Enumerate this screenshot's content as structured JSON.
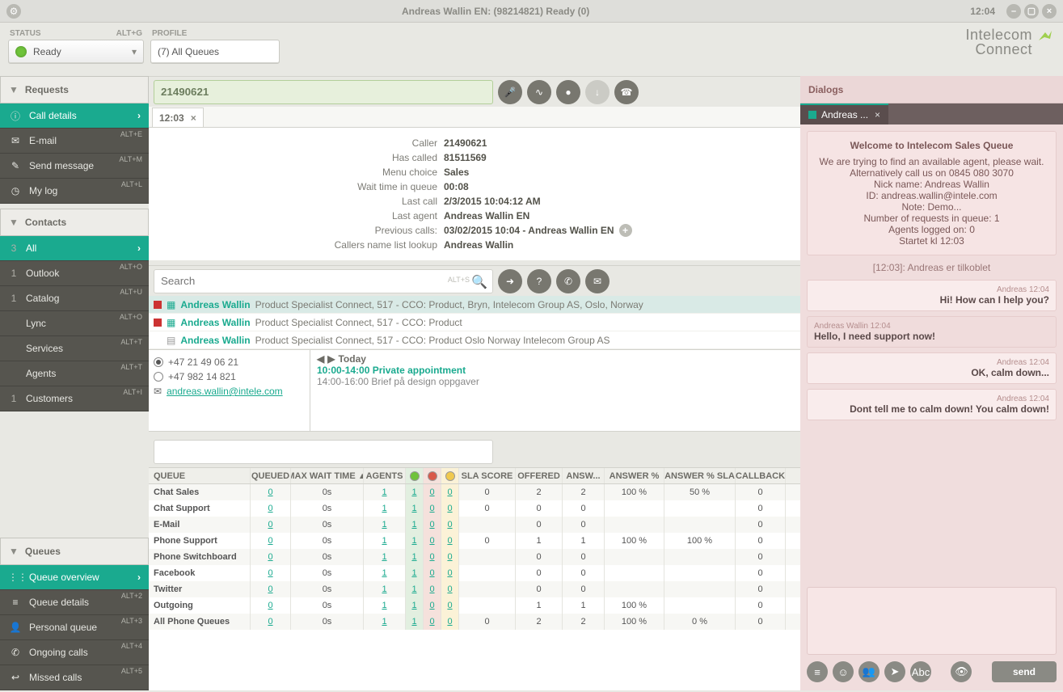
{
  "titlebar": {
    "title": "Andreas Wallin EN: (98214821) Ready  (0)",
    "clock": "12:04"
  },
  "status": {
    "label": "STATUS",
    "shortcut": "ALT+G",
    "value": "Ready"
  },
  "profile": {
    "label": "PROFILE",
    "value": "(7) All Queues"
  },
  "brand": {
    "line1": "Intelecom",
    "line2": "Connect"
  },
  "requests": {
    "hdr": "Requests",
    "items": [
      {
        "icon": "ⓘ",
        "label": "Call details",
        "active": true
      },
      {
        "icon": "✉",
        "label": "E-mail",
        "sc": "ALT+E"
      },
      {
        "icon": "✎",
        "label": "Send message",
        "sc": "ALT+M"
      },
      {
        "icon": "◷",
        "label": "My log",
        "sc": "ALT+L"
      }
    ]
  },
  "callbar": {
    "number": "21490621"
  },
  "tab": {
    "time": "12:03"
  },
  "calldetails": [
    {
      "k": "Caller",
      "v": "21490621"
    },
    {
      "k": "Has called",
      "v": "81511569"
    },
    {
      "k": "Menu choice",
      "v": "Sales"
    },
    {
      "k": "Wait time in queue",
      "v": "00:08"
    },
    {
      "k": "Last call",
      "v": "2/3/2015 10:04:12 AM"
    },
    {
      "k": "Last agent",
      "v": "Andreas Wallin EN"
    },
    {
      "k": "Previous calls:",
      "v": "03/02/2015 10:04 - Andreas Wallin EN",
      "plus": true
    },
    {
      "k": "Callers name list lookup",
      "v": "Andreas Wallin"
    }
  ],
  "contacts": {
    "hdr": "Contacts",
    "searchPlaceholder": "Search",
    "searchShortcut": "ALT+S",
    "items": [
      {
        "cnt": "3",
        "label": "All",
        "active": true
      },
      {
        "cnt": "1",
        "label": "Outlook",
        "sc": "ALT+O"
      },
      {
        "cnt": "1",
        "label": "Catalog",
        "sc": "ALT+U"
      },
      {
        "cnt": "",
        "label": "Lync",
        "sc": "ALT+O"
      },
      {
        "cnt": "",
        "label": "Services",
        "sc": "ALT+T"
      },
      {
        "cnt": "",
        "label": "Agents",
        "sc": "ALT+T"
      },
      {
        "cnt": "1",
        "label": "Customers",
        "sc": "ALT+I"
      }
    ],
    "results": [
      {
        "status": true,
        "name": "Andreas Wallin",
        "rest": "Product Specialist Connect,  517 - CCO: Product,  Bryn,  Intelecom Group AS,  Oslo,  Norway",
        "sel": true
      },
      {
        "status": true,
        "name": "Andreas Wallin",
        "rest": "Product Specialist Connect,  517 - CCO: Product"
      },
      {
        "status": false,
        "name": "Andreas Wallin",
        "rest": "Product Specialist Connect,  517 - CCO: Product Oslo Norway Intelecom Group AS"
      }
    ],
    "detail": {
      "phones": [
        {
          "num": "+47 21 49 06 21",
          "sel": true
        },
        {
          "num": "+47 982 14 821",
          "sel": false
        }
      ],
      "email": "andreas.wallin@intele.com",
      "today": "Today",
      "events": [
        {
          "time": "10:00-14:00",
          "title": "Private appointment",
          "hl": true
        },
        {
          "time": "14:00-16:00",
          "title": "Brief på design oppgaver"
        }
      ]
    }
  },
  "queues": {
    "hdr": "Queues",
    "items": [
      {
        "icon": "⋮⋮",
        "label": "Queue overview",
        "active": true
      },
      {
        "icon": "≡",
        "label": "Queue details",
        "sc": "ALT+2"
      },
      {
        "icon": "👤",
        "label": "Personal queue",
        "sc": "ALT+3"
      },
      {
        "icon": "✆",
        "label": "Ongoing calls",
        "sc": "ALT+4"
      },
      {
        "icon": "↩",
        "label": "Missed calls",
        "sc": "ALT+5"
      }
    ],
    "cols": [
      "QUEUE",
      "QUEUED",
      "MAX WAIT TIME ▲",
      "AGENTS",
      "",
      "",
      "",
      "SLA SCORE",
      "OFFERED",
      "ANSW...",
      "ANSWER %",
      "ANSWER % SLA",
      "CALLBACK"
    ],
    "rows": [
      {
        "q": "Chat Sales",
        "qd": "0",
        "mw": "0s",
        "ag": "1",
        "g": "1",
        "r": "0",
        "y": "0",
        "sla": "0",
        "of": "2",
        "an": "2",
        "ap": "100 %",
        "aps": "50 %",
        "cb": "0"
      },
      {
        "q": "Chat Support",
        "qd": "0",
        "mw": "0s",
        "ag": "1",
        "g": "1",
        "r": "0",
        "y": "0",
        "sla": "0",
        "of": "0",
        "an": "0",
        "ap": "",
        "aps": "",
        "cb": "0"
      },
      {
        "q": "E-Mail",
        "qd": "0",
        "mw": "0s",
        "ag": "1",
        "g": "1",
        "r": "0",
        "y": "0",
        "sla": "",
        "of": "0",
        "an": "0",
        "ap": "",
        "aps": "",
        "cb": "0"
      },
      {
        "q": "Phone Support",
        "qd": "0",
        "mw": "0s",
        "ag": "1",
        "g": "1",
        "r": "0",
        "y": "0",
        "sla": "0",
        "of": "1",
        "an": "1",
        "ap": "100 %",
        "aps": "100 %",
        "cb": "0"
      },
      {
        "q": "Phone Switchboard",
        "qd": "0",
        "mw": "0s",
        "ag": "1",
        "g": "1",
        "r": "0",
        "y": "0",
        "sla": "",
        "of": "0",
        "an": "0",
        "ap": "",
        "aps": "",
        "cb": "0"
      },
      {
        "q": "Facebook",
        "qd": "0",
        "mw": "0s",
        "ag": "1",
        "g": "1",
        "r": "0",
        "y": "0",
        "sla": "",
        "of": "0",
        "an": "0",
        "ap": "",
        "aps": "",
        "cb": "0"
      },
      {
        "q": "Twitter",
        "qd": "0",
        "mw": "0s",
        "ag": "1",
        "g": "1",
        "r": "0",
        "y": "0",
        "sla": "",
        "of": "0",
        "an": "0",
        "ap": "",
        "aps": "",
        "cb": "0"
      },
      {
        "q": "Outgoing",
        "qd": "0",
        "mw": "0s",
        "ag": "1",
        "g": "1",
        "r": "0",
        "y": "0",
        "sla": "",
        "of": "1",
        "an": "1",
        "ap": "100 %",
        "aps": "",
        "cb": "0"
      },
      {
        "q": "All Phone Queues",
        "qd": "0",
        "mw": "0s",
        "ag": "1",
        "g": "1",
        "r": "0",
        "y": "0",
        "sla": "0",
        "of": "2",
        "an": "2",
        "ap": "100 %",
        "aps": "0 %",
        "cb": "0"
      }
    ]
  },
  "dialogs": {
    "hdr": "Dialogs",
    "tab": "Andreas ...",
    "welcome": {
      "title": "Welcome to Intelecom Sales Queue",
      "lines": [
        "We are trying to find an available agent, please wait.",
        "Alternatively call us on 0845 080 3070",
        "Nick name: Andreas Wallin",
        "ID: andreas.wallin@intele.com",
        "Note: Demo...",
        "Number of requests in queue: 1",
        "Agents logged on: 0",
        "Startet kl 12:03"
      ]
    },
    "connected": "[12:03]: Andreas er tilkoblet",
    "messages": [
      {
        "who": "Andreas",
        "time": "12:04",
        "body": "Hi! How can I help you?",
        "side": "agent"
      },
      {
        "who": "Andreas Wallin",
        "time": "12:04",
        "body": "Hello, I need support now!",
        "side": "me"
      },
      {
        "who": "Andreas",
        "time": "12:04",
        "body": "OK, calm down...",
        "side": "agent"
      },
      {
        "who": "Andreas",
        "time": "12:04",
        "body": "Dont tell me to calm down! You calm down!",
        "side": "agent"
      }
    ],
    "send": "send"
  }
}
